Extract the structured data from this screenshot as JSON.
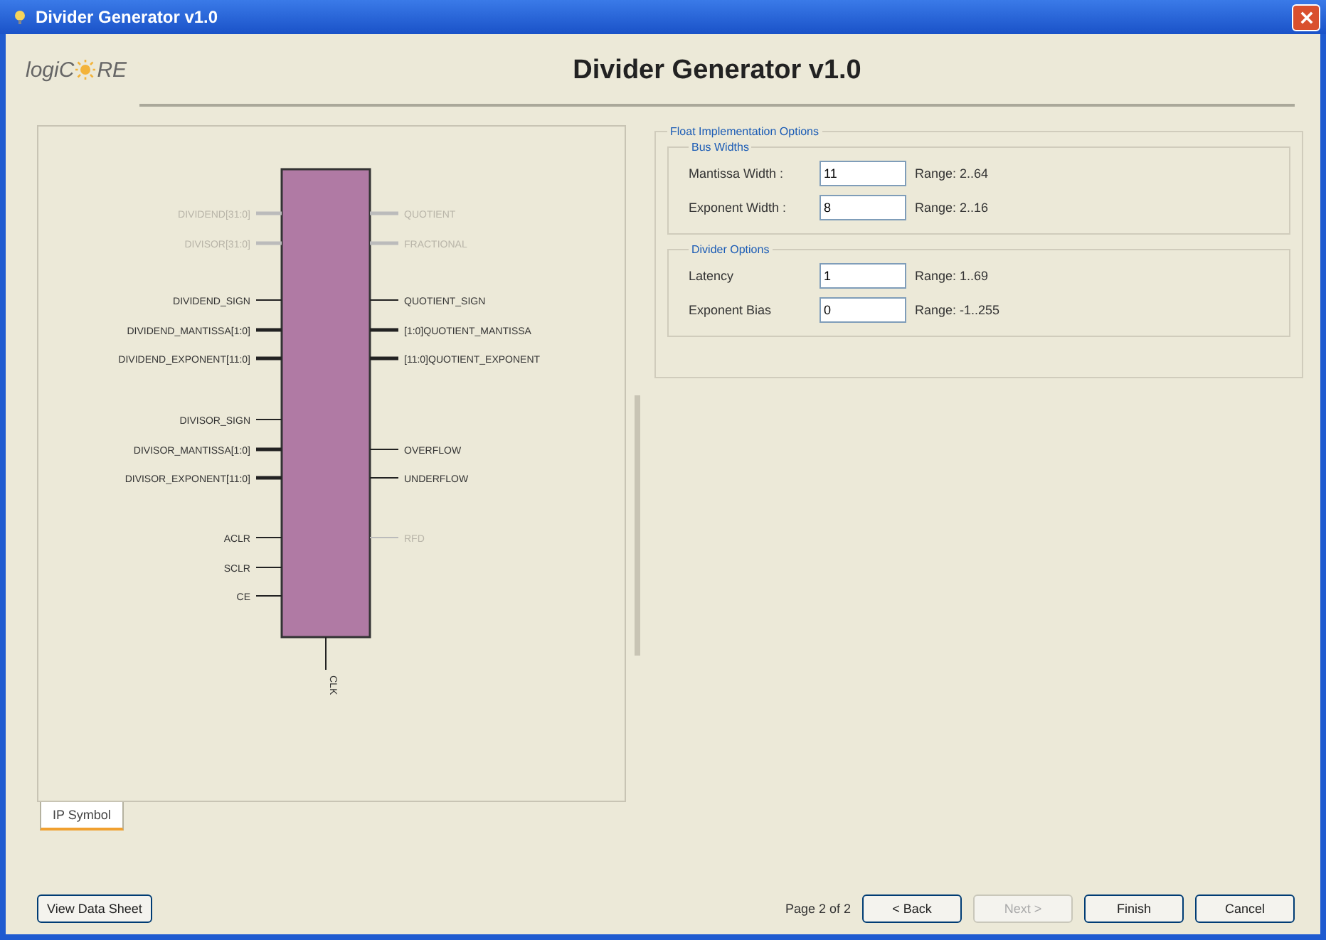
{
  "window": {
    "title": "Divider Generator v1.0"
  },
  "header": {
    "logo_start": "logiC",
    "logo_end": "RE",
    "title": "Divider Generator v1.0"
  },
  "symbol": {
    "left_pins": [
      {
        "label": "DIVIDEND[31:0]",
        "disabled": true,
        "bus": true
      },
      {
        "label": "DIVISOR[31:0]",
        "disabled": true,
        "bus": true
      },
      {
        "label": "DIVIDEND_SIGN",
        "disabled": false,
        "bus": false
      },
      {
        "label": "DIVIDEND_MANTISSA[1:0]",
        "disabled": false,
        "bus": true
      },
      {
        "label": "DIVIDEND_EXPONENT[11:0]",
        "disabled": false,
        "bus": true
      },
      {
        "label": "DIVISOR_SIGN",
        "disabled": false,
        "bus": false
      },
      {
        "label": "DIVISOR_MANTISSA[1:0]",
        "disabled": false,
        "bus": true
      },
      {
        "label": "DIVISOR_EXPONENT[11:0]",
        "disabled": false,
        "bus": true
      },
      {
        "label": "ACLR",
        "disabled": false,
        "bus": false
      },
      {
        "label": "SCLR",
        "disabled": false,
        "bus": false
      },
      {
        "label": "CE",
        "disabled": false,
        "bus": false
      }
    ],
    "right_pins": [
      {
        "label": "QUOTIENT",
        "disabled": true,
        "bus": true
      },
      {
        "label": "FRACTIONAL",
        "disabled": true,
        "bus": true
      },
      {
        "label": "QUOTIENT_SIGN",
        "disabled": false,
        "bus": false
      },
      {
        "label": "[1:0]QUOTIENT_MANTISSA",
        "disabled": false,
        "bus": true
      },
      {
        "label": "[11:0]QUOTIENT_EXPONENT",
        "disabled": false,
        "bus": true
      },
      {
        "label": "OVERFLOW",
        "disabled": false,
        "bus": false
      },
      {
        "label": "UNDERFLOW",
        "disabled": false,
        "bus": false
      },
      {
        "label": "RFD",
        "disabled": true,
        "bus": false
      }
    ],
    "bottom_pin": {
      "label": "CLK"
    }
  },
  "tabs": [
    {
      "label": "IP Symbol",
      "selected": true
    }
  ],
  "options": {
    "title": "Float Implementation Options",
    "groups": [
      {
        "title": "Bus Widths",
        "fields": [
          {
            "label": "Mantissa Width :",
            "value": "11",
            "range": "Range: 2..64"
          },
          {
            "label": "Exponent Width :",
            "value": "8",
            "range": "Range: 2..16"
          }
        ]
      },
      {
        "title": "Divider Options",
        "fields": [
          {
            "label": "Latency",
            "value": "1",
            "range": "Range: 1..69"
          },
          {
            "label": "Exponent Bias",
            "value": "0",
            "range": "Range: -1..255"
          }
        ]
      }
    ]
  },
  "footer": {
    "datasheet": "View Data Sheet",
    "page": "Page 2 of 2",
    "buttons": [
      {
        "label": "< Back",
        "disabled": false
      },
      {
        "label": "Next >",
        "disabled": true
      },
      {
        "label": "Finish",
        "disabled": false
      },
      {
        "label": "Cancel",
        "disabled": false
      }
    ]
  }
}
